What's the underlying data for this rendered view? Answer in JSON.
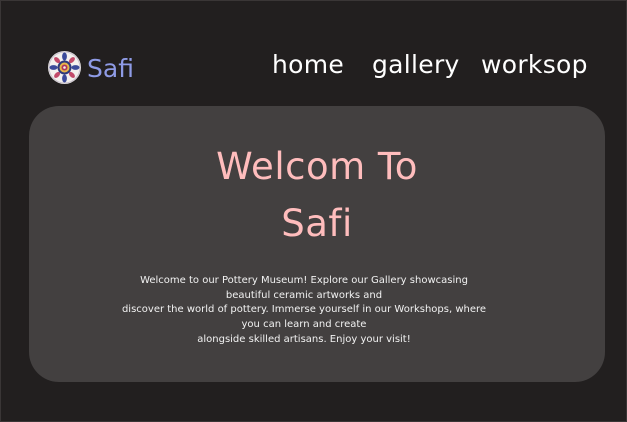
{
  "header": {
    "brand": "Safi",
    "logo_icon": "mandala-icon",
    "nav": [
      {
        "label": "home"
      },
      {
        "label": "gallery"
      },
      {
        "label": "worksop"
      }
    ]
  },
  "hero": {
    "title_lines": [
      "Welcom To",
      "Safi"
    ],
    "text_lines": [
      "Welcome to our Pottery Museum! Explore our Gallery showcasing",
      "beautiful ceramic artworks and",
      "discover the world of pottery. Immerse yourself in our Workshops, where",
      "you can learn and create",
      "alongside skilled artisans. Enjoy your visit!"
    ]
  },
  "colors": {
    "page_background": "#221f1f",
    "hero_background": "#434040",
    "brand": "#8f9be6",
    "title": "#ffbdbd",
    "nav_text": "#ffffff"
  }
}
